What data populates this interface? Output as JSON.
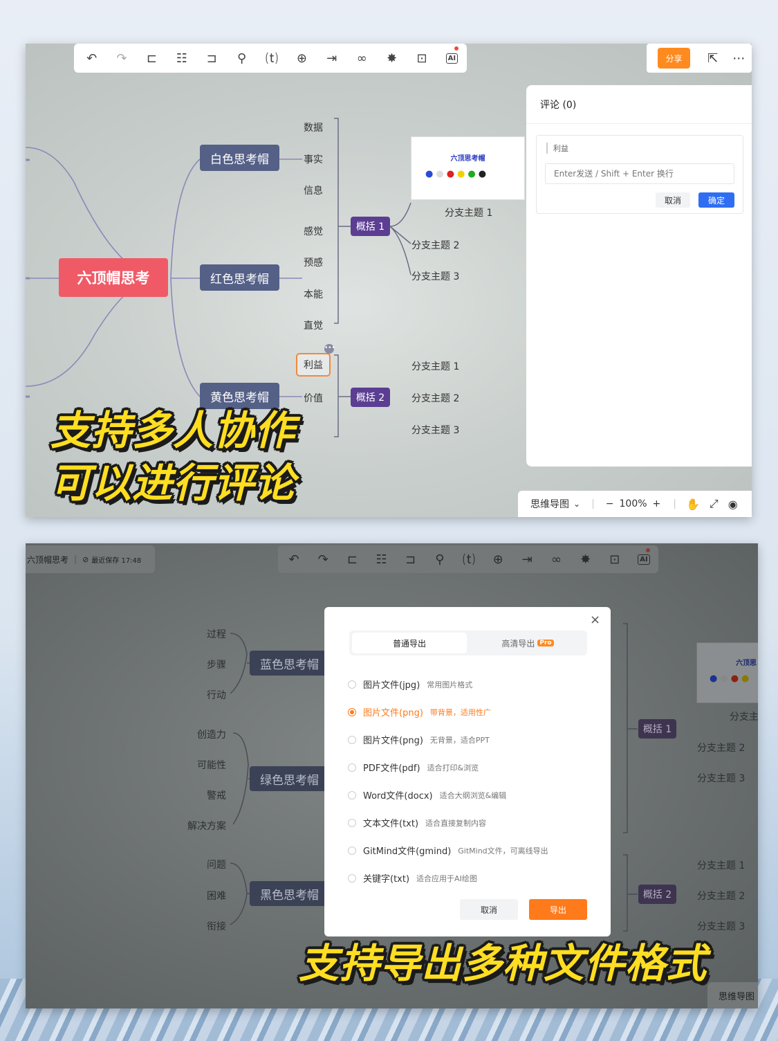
{
  "top_panel": {
    "toolbar_icons": [
      "undo-icon",
      "redo-icon",
      "add-child-icon",
      "add-sibling-icon",
      "add-parent-icon",
      "format-painter-icon",
      "text-icon",
      "insert-icon",
      "summary-icon",
      "link-icon",
      "style-icon",
      "present-icon",
      "ai-icon"
    ],
    "share_label": "分享",
    "mindmap": {
      "root": "六顶帽思考",
      "hats": [
        "白色思考帽",
        "红色思考帽",
        "黄色思考帽"
      ],
      "leaves": [
        "数据",
        "事实",
        "信息",
        "感觉",
        "预感",
        "本能",
        "直觉",
        "利益",
        "价值"
      ],
      "summaries": [
        "概括 1",
        "概括 2"
      ],
      "thumbnail_title": "六顶思考帽",
      "branches_top": [
        "分支主题 1",
        "分支主题 2",
        "分支主题 3"
      ],
      "branches_bottom": [
        "分支主题 1",
        "分支主题 2",
        "分支主题 3"
      ]
    },
    "comment_panel": {
      "title": "评论 (0)",
      "quote": "利益",
      "placeholder": "Enter发送 / Shift + Enter 换行",
      "cancel": "取消",
      "confirm": "确定"
    },
    "status_bar": {
      "mode": "思维导图",
      "zoom": "100%"
    },
    "caption_line1": "支持多人协作",
    "caption_line2": "可以进行评论"
  },
  "bottom_panel": {
    "doc_title": "六顶帽思考",
    "saved": "最近保存 17:48",
    "mindmap": {
      "hats": [
        "蓝色思考帽",
        "绿色思考帽",
        "黑色思考帽"
      ],
      "leaves": [
        "过程",
        "步骤",
        "行动",
        "创造力",
        "可能性",
        "警戒",
        "解决方案",
        "问题",
        "困难",
        "衔接"
      ],
      "summaries": [
        "概括 1",
        "概括 2"
      ],
      "thumbnail_title": "六顶思",
      "branch_partial": "分支主",
      "branches_top": [
        "分支主题 2",
        "分支主题 3"
      ],
      "branches_bottom": [
        "分支主题 1",
        "分支主题 2",
        "分支主题 3"
      ]
    },
    "export_dialog": {
      "tab_normal": "普通导出",
      "tab_hd": "高清导出",
      "pro_badge": "Pro",
      "options": [
        {
          "name": "图片文件(jpg)",
          "desc": "常用图片格式",
          "selected": false
        },
        {
          "name": "图片文件(png)",
          "desc": "带背景，适用性广",
          "selected": true
        },
        {
          "name": "图片文件(png)",
          "desc": "无背景，适合PPT",
          "selected": false
        },
        {
          "name": "PDF文件(pdf)",
          "desc": "适合打印&浏览",
          "selected": false
        },
        {
          "name": "Word文件(docx)",
          "desc": "适合大纲浏览&编辑",
          "selected": false
        },
        {
          "name": "文本文件(txt)",
          "desc": "适合直接复制内容",
          "selected": false
        },
        {
          "name": "GitMind文件(gmind)",
          "desc": "GitMind文件，可离线导出",
          "selected": false
        },
        {
          "name": "关键字(txt)",
          "desc": "适合应用于AI绘图",
          "selected": false
        }
      ],
      "cancel": "取消",
      "export": "导出"
    },
    "status_mode": "思维导图",
    "caption": "支持导出多种文件格式"
  }
}
